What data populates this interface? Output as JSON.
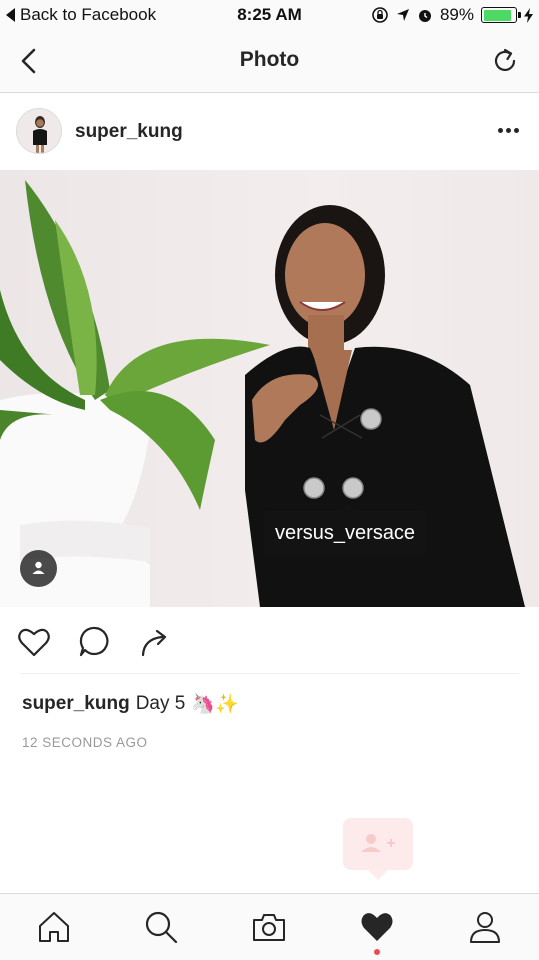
{
  "status_bar": {
    "back_label": "Back to Facebook",
    "time": "8:25 AM",
    "battery_percent": "89%",
    "battery_level": 0.89,
    "icons": [
      "orientation-lock-icon",
      "location-arrow-icon",
      "alarm-icon",
      "battery-icon",
      "charging-bolt-icon"
    ]
  },
  "nav": {
    "title": "Photo",
    "back_icon": "chevron-left-icon",
    "refresh_icon": "refresh-icon"
  },
  "post": {
    "username": "super_kung",
    "more_icon": "more-dots-icon",
    "photo_tag": "versus_versace",
    "user_tag_icon": "person-icon"
  },
  "actions": {
    "icons": [
      "heart-icon",
      "comment-icon",
      "share-icon"
    ]
  },
  "caption": {
    "username": "super_kung",
    "text": "Day 5",
    "emoji": "🦄✨"
  },
  "timestamp": "12 SECONDS AGO",
  "tab_bar": {
    "items": [
      "home-icon",
      "search-icon",
      "camera-icon",
      "activity-heart-icon",
      "profile-icon"
    ],
    "active": "activity-heart-icon"
  },
  "colors": {
    "text": "#262626",
    "muted": "#999999",
    "notification": "#ed4956",
    "battery": "#4cd964"
  }
}
